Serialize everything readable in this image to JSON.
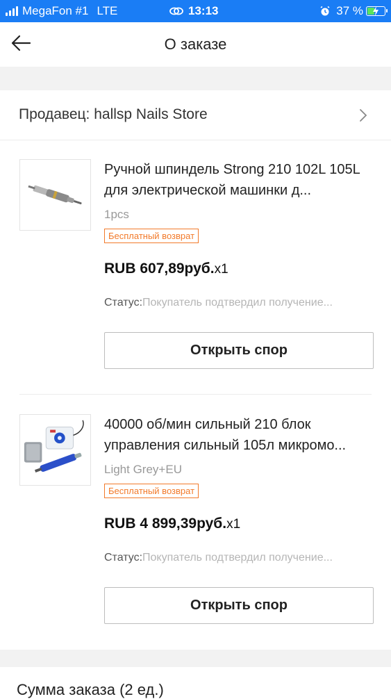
{
  "status_bar": {
    "carrier": "MegaFon #1",
    "network": "LTE",
    "time": "13:13",
    "battery": "37 %",
    "battery_level": 0.37,
    "icons": [
      "signal-icon",
      "link-icon",
      "alarm-icon",
      "battery-icon"
    ]
  },
  "header": {
    "title": "О заказе",
    "back_icon": "arrow-left-icon"
  },
  "seller": {
    "label": "Продавец: hallsp Nails Store",
    "chevron_icon": "chevron-right-icon"
  },
  "items": [
    {
      "title": "Ручной шпиндель Strong 210 102L 105L для электрической машинки д...",
      "variant": "1pcs",
      "badge": "Бесплатный возврат",
      "price": "RUB 607,89руб.",
      "quantity": "x1",
      "status_label": "Статус:",
      "status_value": "Покупатель подтвердил получение...",
      "button": "Открыть спор"
    },
    {
      "title": "40000 об/мин сильный 210 блок управления сильный 105л микромо...",
      "variant": "Light Grey+EU",
      "badge": "Бесплатный возврат",
      "price": "RUB 4 899,39руб.",
      "quantity": "x1",
      "status_label": "Статус:",
      "status_value": "Покупатель подтвердил получение...",
      "button": "Открыть спор"
    }
  ],
  "summary": {
    "label": "Сумма заказа (2 ед.)"
  },
  "colors": {
    "status_bar": "#1a7df5",
    "badge": "#f27a2a",
    "background_gap": "#f2f2f2"
  }
}
